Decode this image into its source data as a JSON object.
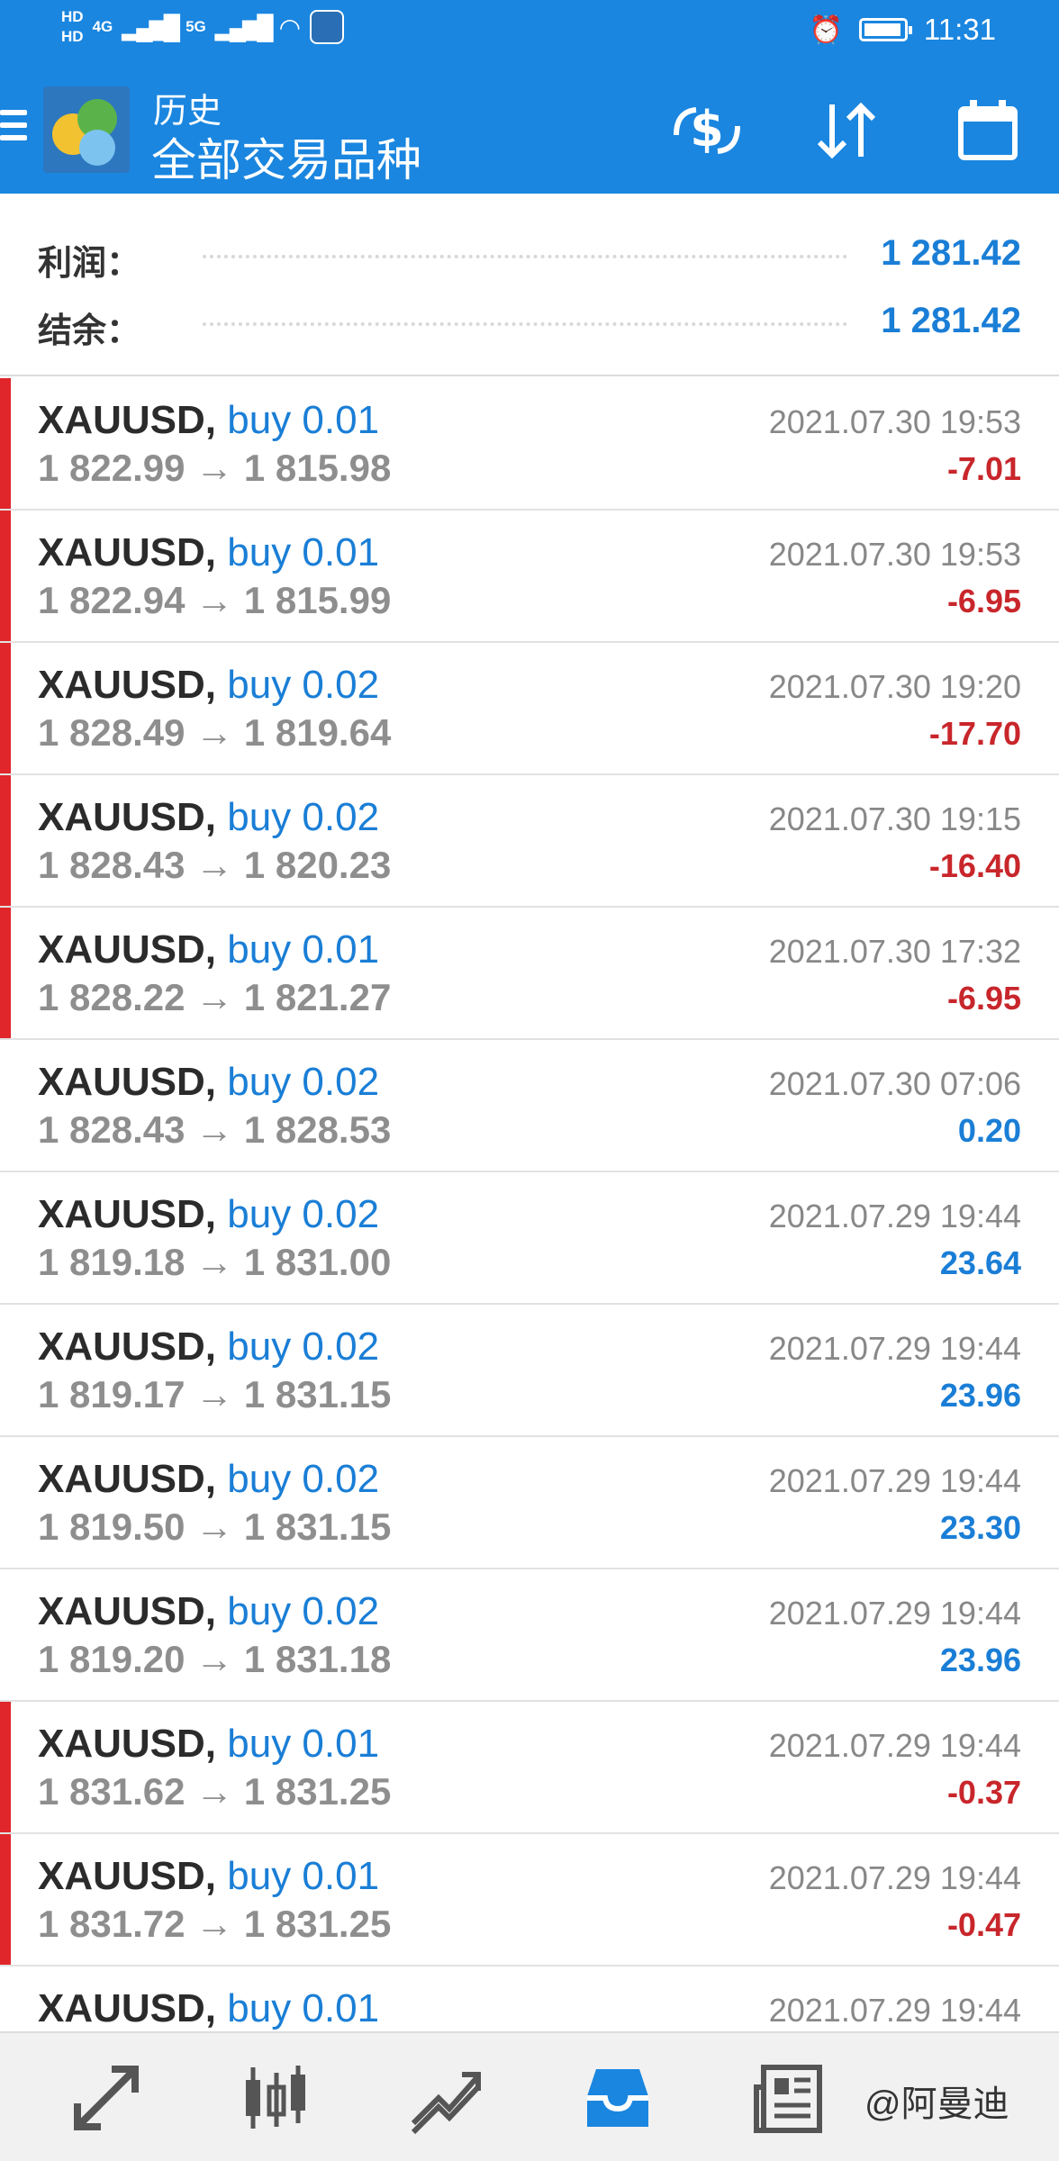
{
  "status_bar": {
    "left": [
      "HD",
      "HD",
      "4G",
      "5G"
    ],
    "time": "11:31"
  },
  "app_bar": {
    "subtitle": "历史",
    "title": "全部交易品种"
  },
  "icons": {
    "menu": "menu-icon",
    "currency": "currency-exchange-icon",
    "sort": "sort-icon",
    "calendar": "calendar-icon"
  },
  "summary": {
    "profit_label": "利润：",
    "profit_value": "1 281.42",
    "balance_label": "结余：",
    "balance_value": "1 281.42"
  },
  "trades": [
    {
      "symbol": "XAUUSD,",
      "side": "buy 0.01",
      "prices": "1 822.99 → 1 815.98",
      "datetime": "2021.07.30 19:53",
      "pl": "-7.01",
      "loss": true
    },
    {
      "symbol": "XAUUSD,",
      "side": "buy 0.01",
      "prices": "1 822.94 → 1 815.99",
      "datetime": "2021.07.30 19:53",
      "pl": "-6.95",
      "loss": true
    },
    {
      "symbol": "XAUUSD,",
      "side": "buy 0.02",
      "prices": "1 828.49 → 1 819.64",
      "datetime": "2021.07.30 19:20",
      "pl": "-17.70",
      "loss": true
    },
    {
      "symbol": "XAUUSD,",
      "side": "buy 0.02",
      "prices": "1 828.43 → 1 820.23",
      "datetime": "2021.07.30 19:15",
      "pl": "-16.40",
      "loss": true
    },
    {
      "symbol": "XAUUSD,",
      "side": "buy 0.01",
      "prices": "1 828.22 → 1 821.27",
      "datetime": "2021.07.30 17:32",
      "pl": "-6.95",
      "loss": true
    },
    {
      "symbol": "XAUUSD,",
      "side": "buy 0.02",
      "prices": "1 828.43 → 1 828.53",
      "datetime": "2021.07.30 07:06",
      "pl": "0.20",
      "loss": false
    },
    {
      "symbol": "XAUUSD,",
      "side": "buy 0.02",
      "prices": "1 819.18 → 1 831.00",
      "datetime": "2021.07.29 19:44",
      "pl": "23.64",
      "loss": false
    },
    {
      "symbol": "XAUUSD,",
      "side": "buy 0.02",
      "prices": "1 819.17 → 1 831.15",
      "datetime": "2021.07.29 19:44",
      "pl": "23.96",
      "loss": false
    },
    {
      "symbol": "XAUUSD,",
      "side": "buy 0.02",
      "prices": "1 819.50 → 1 831.15",
      "datetime": "2021.07.29 19:44",
      "pl": "23.30",
      "loss": false
    },
    {
      "symbol": "XAUUSD,",
      "side": "buy 0.02",
      "prices": "1 819.20 → 1 831.18",
      "datetime": "2021.07.29 19:44",
      "pl": "23.96",
      "loss": false
    },
    {
      "symbol": "XAUUSD,",
      "side": "buy 0.01",
      "prices": "1 831.62 → 1 831.25",
      "datetime": "2021.07.29 19:44",
      "pl": "-0.37",
      "loss": true
    },
    {
      "symbol": "XAUUSD,",
      "side": "buy 0.01",
      "prices": "1 831.72 → 1 831.25",
      "datetime": "2021.07.29 19:44",
      "pl": "-0.47",
      "loss": true
    },
    {
      "symbol": "XAUUSD,",
      "side": "buy 0.01",
      "prices": "",
      "datetime": "2021.07.29 19:44",
      "pl": "",
      "loss": false
    }
  ],
  "bottom_nav": [
    {
      "icon": "trade-icon",
      "glyph": "⇗",
      "active": false
    },
    {
      "icon": "chart-candles-icon",
      "glyph": "⫴",
      "active": false
    },
    {
      "icon": "trend-chart-icon",
      "glyph": "⟋",
      "active": false
    },
    {
      "icon": "history-inbox-icon",
      "glyph": "▣",
      "active": true
    },
    {
      "icon": "news-icon",
      "glyph": "▤",
      "active": false
    }
  ],
  "watermark": "@阿曼迪",
  "colors": {
    "header": "#1a86e0",
    "accent_blue": "#1a7ed6",
    "loss_red": "#c8262b",
    "loss_bar": "#e0262b"
  }
}
